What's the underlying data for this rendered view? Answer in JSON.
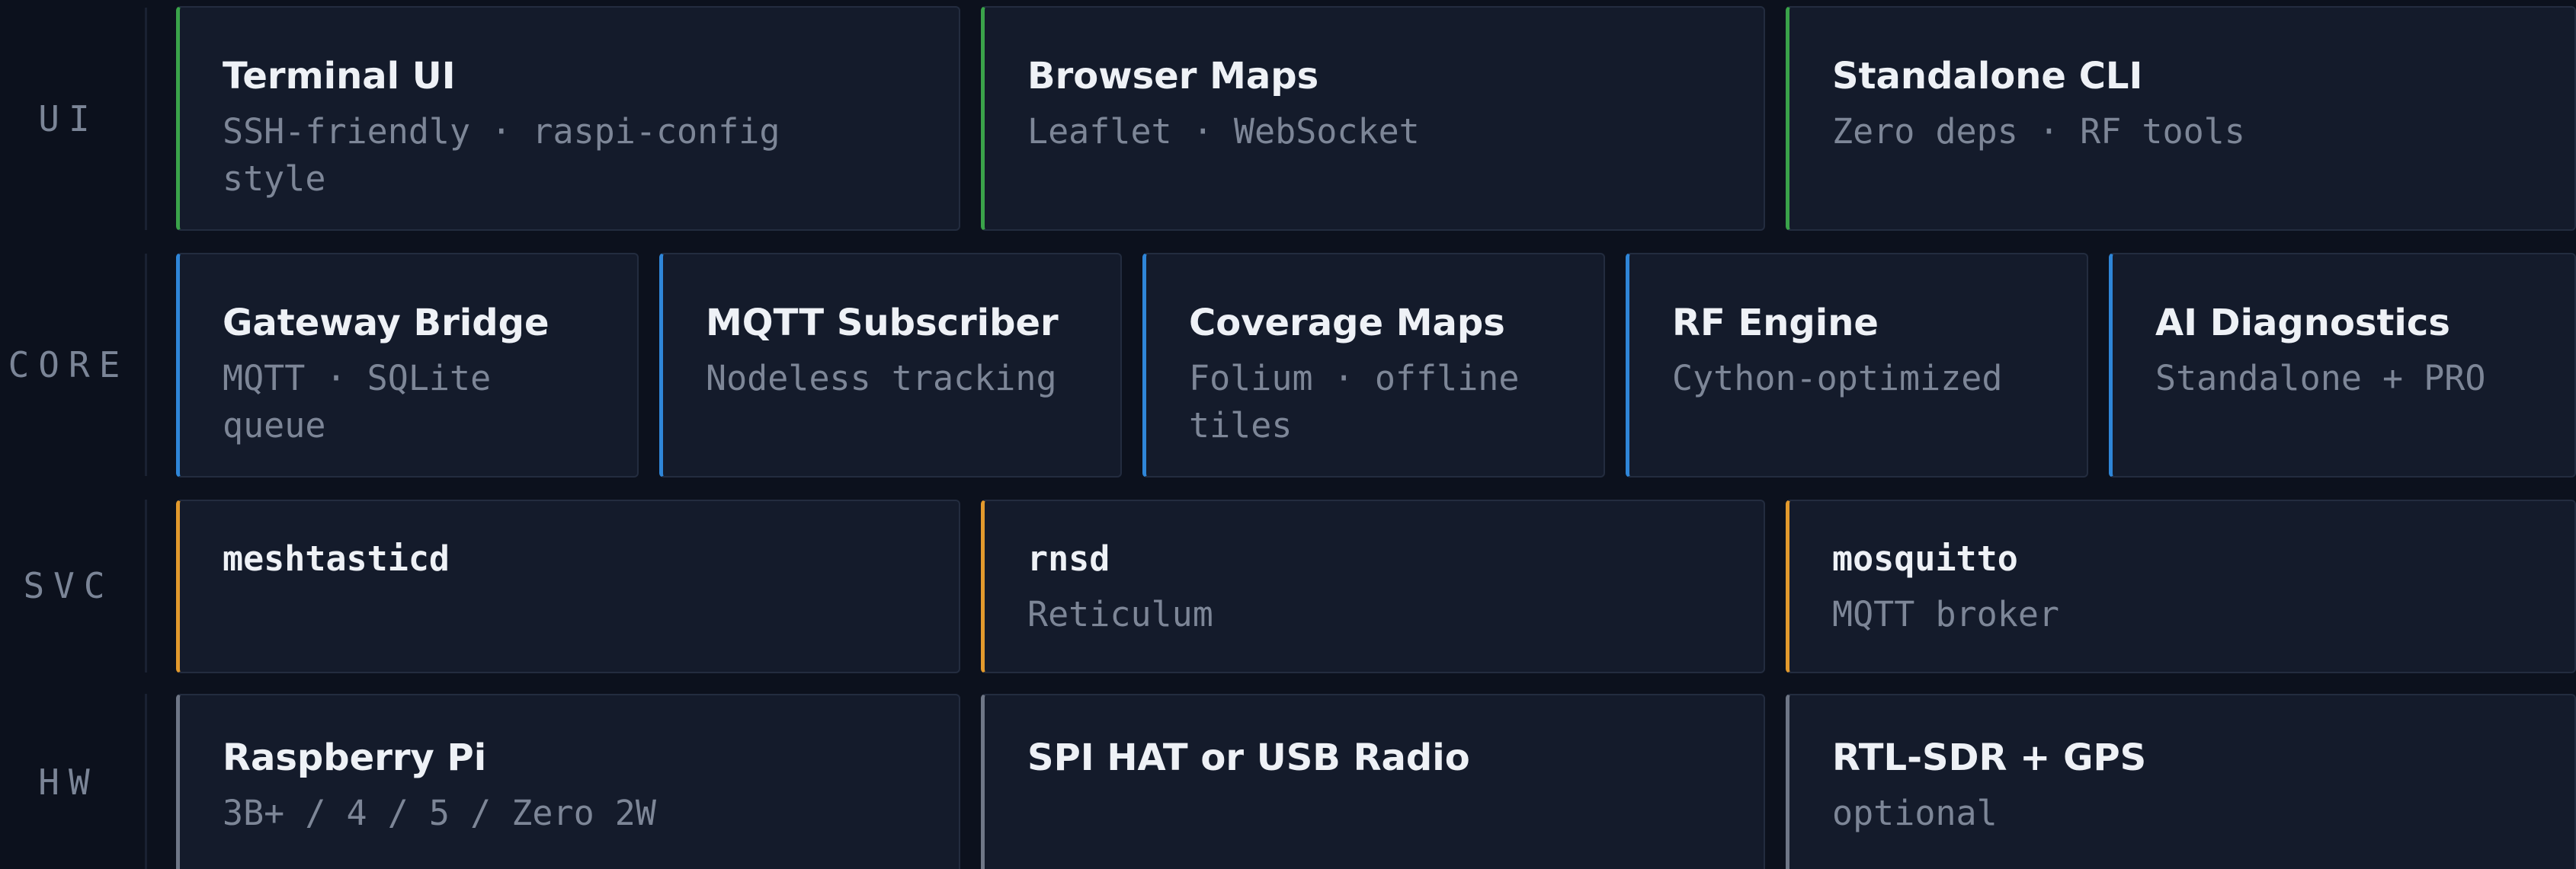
{
  "layers": {
    "ui": {
      "label": "UI",
      "cards": [
        {
          "title": "Terminal UI",
          "subtitle": "SSH-friendly · raspi-config style"
        },
        {
          "title": "Browser Maps",
          "subtitle": "Leaflet · WebSocket"
        },
        {
          "title": "Standalone CLI",
          "subtitle": "Zero deps · RF tools"
        }
      ]
    },
    "core": {
      "label": "CORE",
      "cards": [
        {
          "title": "Gateway Bridge",
          "subtitle": "MQTT · SQLite queue"
        },
        {
          "title": "MQTT Subscriber",
          "subtitle": "Nodeless tracking"
        },
        {
          "title": "Coverage Maps",
          "subtitle": "Folium · offline tiles"
        },
        {
          "title": "RF Engine",
          "subtitle": "Cython-optimized"
        },
        {
          "title": "AI Diagnostics",
          "subtitle": "Standalone + PRO"
        }
      ]
    },
    "svc": {
      "label": "SVC",
      "cards": [
        {
          "title": "meshtasticd",
          "subtitle": ""
        },
        {
          "title": "rnsd",
          "subtitle": "Reticulum"
        },
        {
          "title": "mosquitto",
          "subtitle": "MQTT broker"
        }
      ]
    },
    "hw": {
      "label": "HW",
      "cards": [
        {
          "title": "Raspberry Pi",
          "subtitle": "3B+ / 4 / 5 / Zero 2W"
        },
        {
          "title": "SPI HAT or USB Radio",
          "subtitle": ""
        },
        {
          "title": "RTL-SDR + GPS",
          "subtitle": "optional"
        }
      ]
    }
  },
  "colors": {
    "ui_accent": "#3aa34a",
    "core_accent": "#2f86d8",
    "svc_accent": "#e39a2d",
    "hw_accent": "#6f7787",
    "background": "#0c111d",
    "card_background": "#141b2b"
  }
}
